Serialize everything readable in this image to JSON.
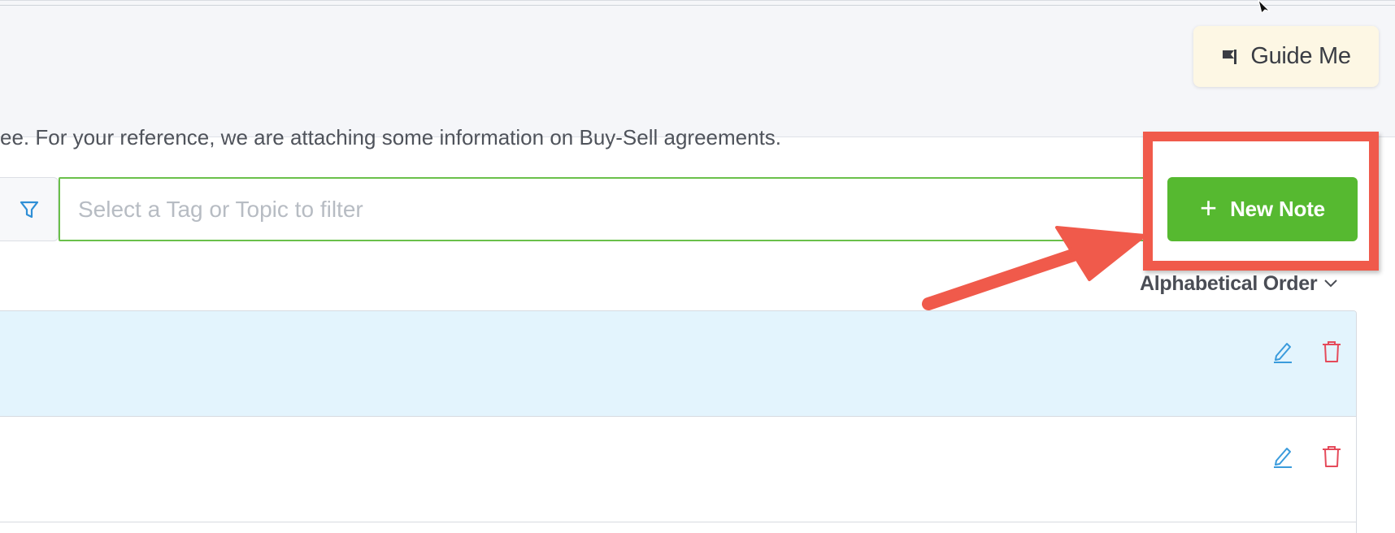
{
  "header": {
    "guide_button_label": "Guide Me",
    "colors": {
      "guide_bg": "#fdf7e4",
      "band_bg": "#f5f6f9"
    }
  },
  "filter": {
    "placeholder": "Select a Tag or Topic to filter",
    "value": "",
    "icon": "filter-icon",
    "accent": "#6ac04a"
  },
  "toolbar": {
    "new_note_label": "New Note",
    "new_note_icon": "plus-icon",
    "new_note_color": "#56b930"
  },
  "sort": {
    "selected": "Alphabetical Order",
    "icon": "chevron-down-icon"
  },
  "annotation": {
    "highlight_color": "#f05a4b"
  },
  "notes": [
    {
      "text": "",
      "edit_icon": "pencil-icon",
      "delete_icon": "trash-icon"
    },
    {
      "text": "ee. For your reference, we are attaching some information on Buy-Sell agreements.",
      "edit_icon": "pencil-icon",
      "delete_icon": "trash-icon"
    }
  ],
  "icon_colors": {
    "edit": "#3a9bdc",
    "delete": "#e54a5a"
  }
}
